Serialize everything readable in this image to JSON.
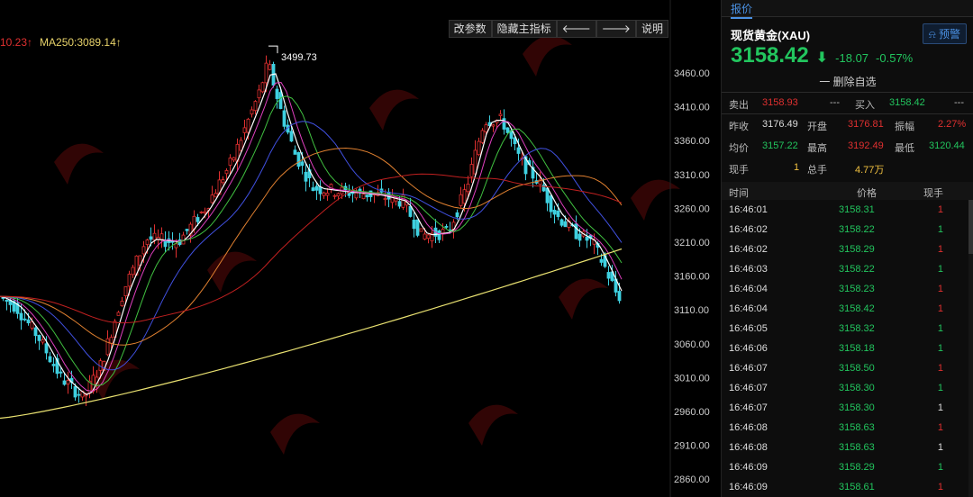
{
  "toolbar": {
    "change_params": "改参数",
    "hide_indicator": "隐藏主指标",
    "left_arrow": "🡐",
    "right_arrow": "🡒",
    "help": "说明"
  },
  "legend": {
    "ma_prev": "10.23↑",
    "ma250": "MA250:3089.14↑"
  },
  "annotation": {
    "peak": "3499.73"
  },
  "y_axis": {
    "ticks": [
      "3460.00",
      "3410.00",
      "3360.00",
      "3310.00",
      "3260.00",
      "3210.00",
      "3160.00",
      "3110.00",
      "3060.00",
      "3010.00",
      "2960.00",
      "2910.00",
      "2860.00"
    ]
  },
  "colors": {
    "up": "#e03030",
    "down": "#22c55e",
    "candle_up_fill": "#000000",
    "candle_dn": "#3fd0e0",
    "ma_white": "#ffffff",
    "ma_magenta": "#e040c0",
    "ma_green": "#40c040",
    "ma_blue": "#4050e0",
    "ma_orange": "#e08030",
    "ma_red": "#c02020",
    "ma_yellow": "#e8e070",
    "accent": "#4a90e2"
  },
  "panel": {
    "tab": "报价",
    "symbol": "现货黄金(XAU)",
    "alert": "预警",
    "price": "3158.42",
    "arrow": "⬇",
    "change": "-18.07",
    "change_pct": "-0.57%",
    "delete_fav": "一 删除自选",
    "sell_label": "卖出",
    "sell_price": "3158.93",
    "sell_dash": "---",
    "buy_label": "买入",
    "buy_price": "3158.42",
    "buy_dash": "---",
    "prev_close_label": "昨收",
    "prev_close": "3176.49",
    "open_label": "开盘",
    "open": "3176.81",
    "amp_label": "振幅",
    "amp": "2.27%",
    "avg_label": "均价",
    "avg": "3157.22",
    "high_label": "最高",
    "high": "3192.49",
    "low_label": "最低",
    "low": "3120.44",
    "cur_vol_label": "现手",
    "cur_vol": "1",
    "total_vol_label": "总手",
    "total_vol": "4.77万",
    "col_time": "时间",
    "col_price": "价格",
    "col_vol": "现手",
    "ticks": [
      {
        "time": "16:46:01",
        "price": "3158.31",
        "vol": "1",
        "dir": "up"
      },
      {
        "time": "16:46:02",
        "price": "3158.22",
        "vol": "1",
        "dir": "down"
      },
      {
        "time": "16:46:02",
        "price": "3158.29",
        "vol": "1",
        "dir": "up"
      },
      {
        "time": "16:46:03",
        "price": "3158.22",
        "vol": "1",
        "dir": "down"
      },
      {
        "time": "16:46:04",
        "price": "3158.23",
        "vol": "1",
        "dir": "up"
      },
      {
        "time": "16:46:04",
        "price": "3158.42",
        "vol": "1",
        "dir": "up"
      },
      {
        "time": "16:46:05",
        "price": "3158.32",
        "vol": "1",
        "dir": "down"
      },
      {
        "time": "16:46:06",
        "price": "3158.18",
        "vol": "1",
        "dir": "down"
      },
      {
        "time": "16:46:07",
        "price": "3158.50",
        "vol": "1",
        "dir": "up"
      },
      {
        "time": "16:46:07",
        "price": "3158.30",
        "vol": "1",
        "dir": "down"
      },
      {
        "time": "16:46:07",
        "price": "3158.30",
        "vol": "1",
        "dir": "flat"
      },
      {
        "time": "16:46:08",
        "price": "3158.63",
        "vol": "1",
        "dir": "up"
      },
      {
        "time": "16:46:08",
        "price": "3158.63",
        "vol": "1",
        "dir": "flat"
      },
      {
        "time": "16:46:09",
        "price": "3158.29",
        "vol": "1",
        "dir": "down"
      },
      {
        "time": "16:46:09",
        "price": "3158.61",
        "vol": "1",
        "dir": "up"
      }
    ]
  }
}
